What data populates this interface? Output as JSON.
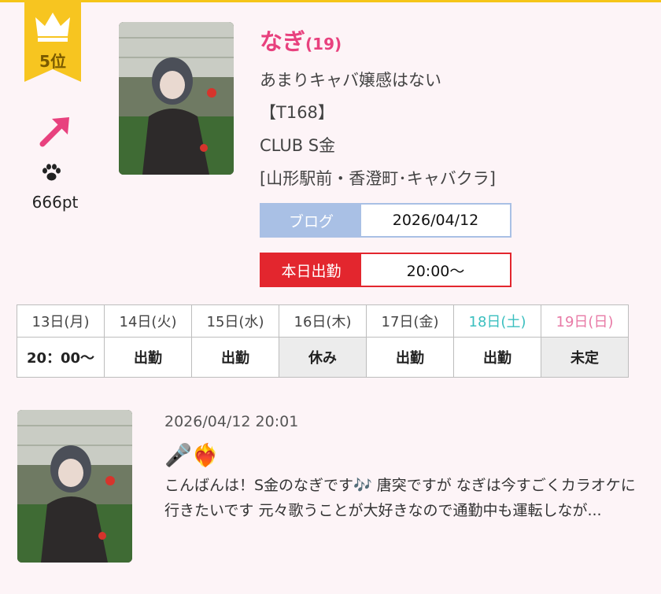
{
  "rank": {
    "label": "5位",
    "trend_icon": "arrow-up-right-icon",
    "trend_color": "#e8417e",
    "points": "666pt",
    "ribbon_color": "#f5c518"
  },
  "profile": {
    "name": "なぎ",
    "age": "(19)",
    "catchphrase": "あまりキャバ嬢感はない",
    "height": "【T168】",
    "shop": "CLUB S金",
    "area": "[山形駅前・香澄町･キャバクラ]"
  },
  "blog": {
    "label": "ブログ",
    "date": "2026/04/12"
  },
  "today": {
    "label": "本日出勤",
    "time": "20:00〜"
  },
  "schedule": {
    "days": [
      "13日(月)",
      "14日(火)",
      "15日(水)",
      "16日(木)",
      "17日(金)",
      "18日(土)",
      "19日(日)"
    ],
    "values": [
      "20：00〜",
      "出勤",
      "出勤",
      "休み",
      "出勤",
      "出勤",
      "未定"
    ]
  },
  "post": {
    "datetime": "2026/04/12 20:01",
    "emoji": "🎤❤️‍🔥",
    "body": "こんばんは！S金のなぎです🎶 唐突ですが なぎは今すごくカラオケに行きたいです 元々歌うことが大好きなので通勤中も運転しなが..."
  }
}
